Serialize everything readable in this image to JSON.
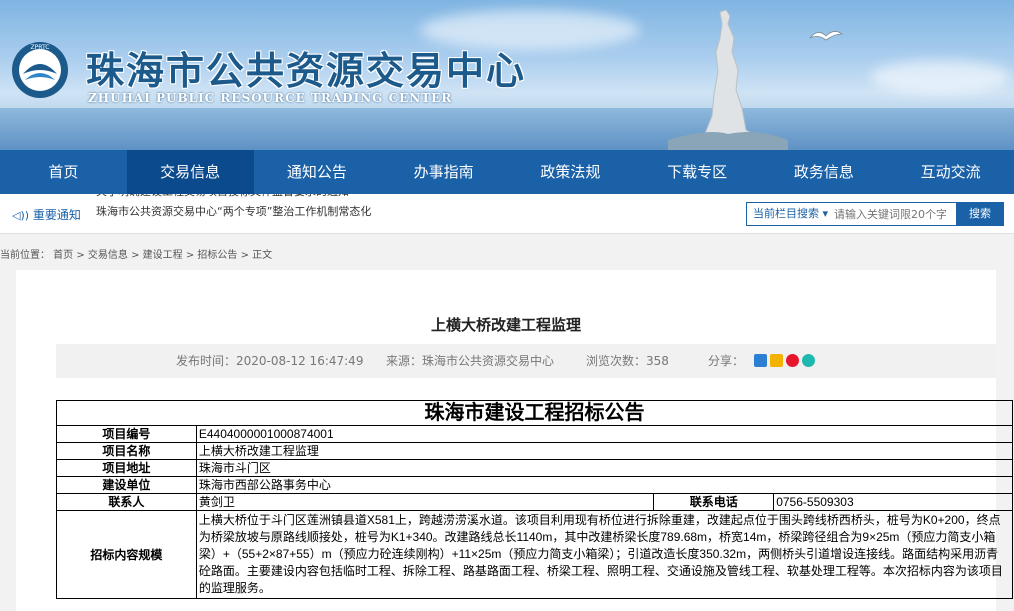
{
  "header": {
    "title": "珠海市公共资源交易中心",
    "subtitle": "ZHUHAI PUBLIC RESOURCE TRADING CENTER",
    "logo_text": "ZPRTC"
  },
  "nav": [
    {
      "label": "首页"
    },
    {
      "label": "交易信息"
    },
    {
      "label": "通知公告"
    },
    {
      "label": "办事指南"
    },
    {
      "label": "政策法规"
    },
    {
      "label": "下载专区"
    },
    {
      "label": "政务信息"
    },
    {
      "label": "互动交流"
    }
  ],
  "notice": {
    "label": "重要通知",
    "lines": [
      "关于明确建设工程交易项目投标文件监督要求的通知",
      "珠海市公共资源交易中心“两个专项”整治工作机制常态化"
    ]
  },
  "search": {
    "scope": "当前栏目搜索 ▾",
    "placeholder": "请输入关键词限20个字",
    "button": "搜索"
  },
  "breadcrumb": {
    "text": "当前位置： 首页 > 交易信息 > 建设工程 > 招标公告 > 正文"
  },
  "article": {
    "title": "上横大桥改建工程监理",
    "publish": "发布时间：2020-08-12 16:47:49",
    "source": "来源：珠海市公共资源交易中心",
    "views": "浏览次数：358",
    "share": "分享："
  },
  "table": {
    "caption": "珠海市建设工程招标公告",
    "rows": {
      "code_label": "项目编号",
      "code_value": "E4404000001000874001",
      "name_label": "项目名称",
      "name_value": "上横大桥改建工程监理",
      "addr_label": "项目地址",
      "addr_value": "珠海市斗门区",
      "owner_label": "建设单位",
      "owner_value": "珠海市西部公路事务中心",
      "contact_label": "联系人",
      "contact_value": "黄剑卫",
      "phone_label": "联系电话",
      "phone_value": "0756-5509303",
      "scope_label": "招标内容规模",
      "scope_value": "上横大桥位于斗门区莲洲镇县道X581上，跨越涝涝溪水道。该项目利用现有桥位进行拆除重建，改建起点位于围头跨线桥西桥头，桩号为K0+200，终点为桥梁放坡与原路线顺接处，桩号为K1+340。改建路线总长1140m，其中改建桥梁长度789.68m，桥宽14m，桥梁跨径组合为9×25m（预应力简支小箱梁）+（55+2×87+55）m（预应力砼连续刚构）+11×25m（预应力简支小箱梁）；引道改造长度350.32m，两侧桥头引道增设连接线。路面结构采用沥青砼路面。主要建设内容包括临时工程、拆除工程、路基路面工程、桥梁工程、照明工程、交通设施及管线工程、软基处理工程等。本次招标内容为该项目的监理服务。"
    }
  },
  "colors": {
    "nav": "#1a61a8",
    "nav_active": "#0b4a8d",
    "title": "#1d5a8c"
  }
}
